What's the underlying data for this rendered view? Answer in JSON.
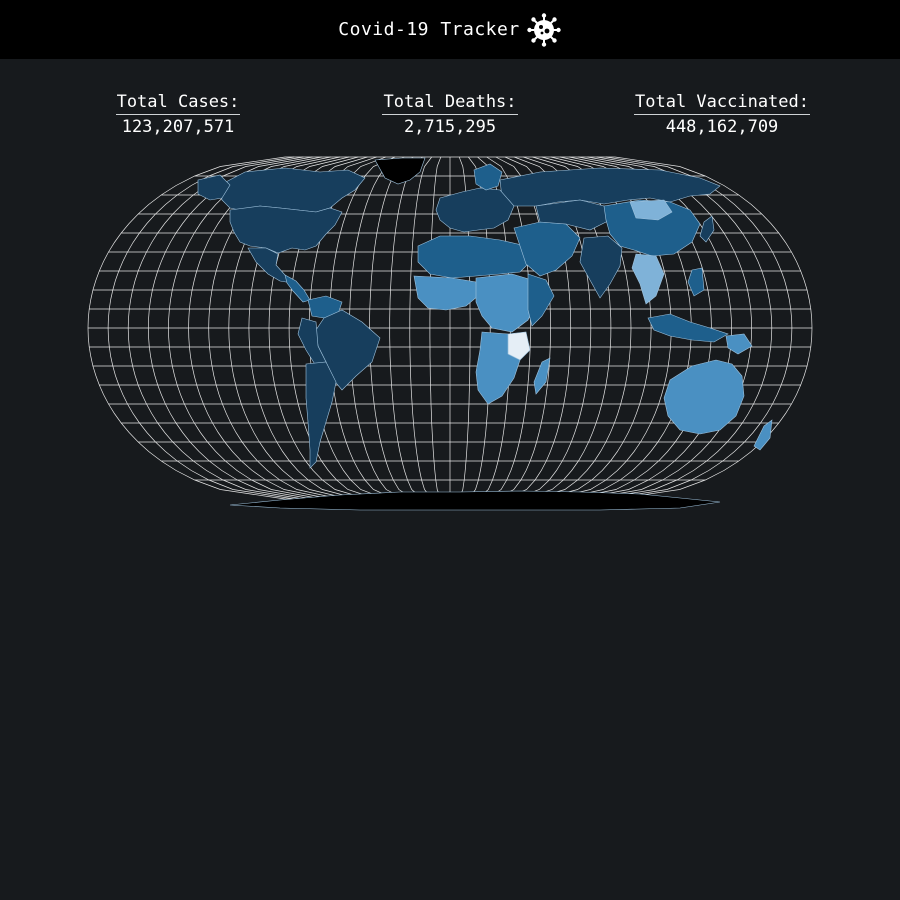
{
  "header": {
    "title": "Covid-19 Tracker",
    "icon": "virus-icon"
  },
  "stats": {
    "cases": {
      "label": "Total Cases:",
      "value": "123,207,571"
    },
    "deaths": {
      "label": "Total Deaths:",
      "value": "2,715,295"
    },
    "vaccinated": {
      "label": "Total Vaccinated:",
      "value": "448,162,709"
    }
  },
  "map": {
    "projection": "Eckert-like pseudocylindrical",
    "colors": {
      "background": "#171a1d",
      "graticule": "#e6e6e6",
      "dark": "#173e5d",
      "mid": "#1e5f8c",
      "light": "#4a90c2",
      "lighter": "#7fb2d8",
      "lightest": "#e5eef6",
      "nodata": "#000000"
    }
  }
}
